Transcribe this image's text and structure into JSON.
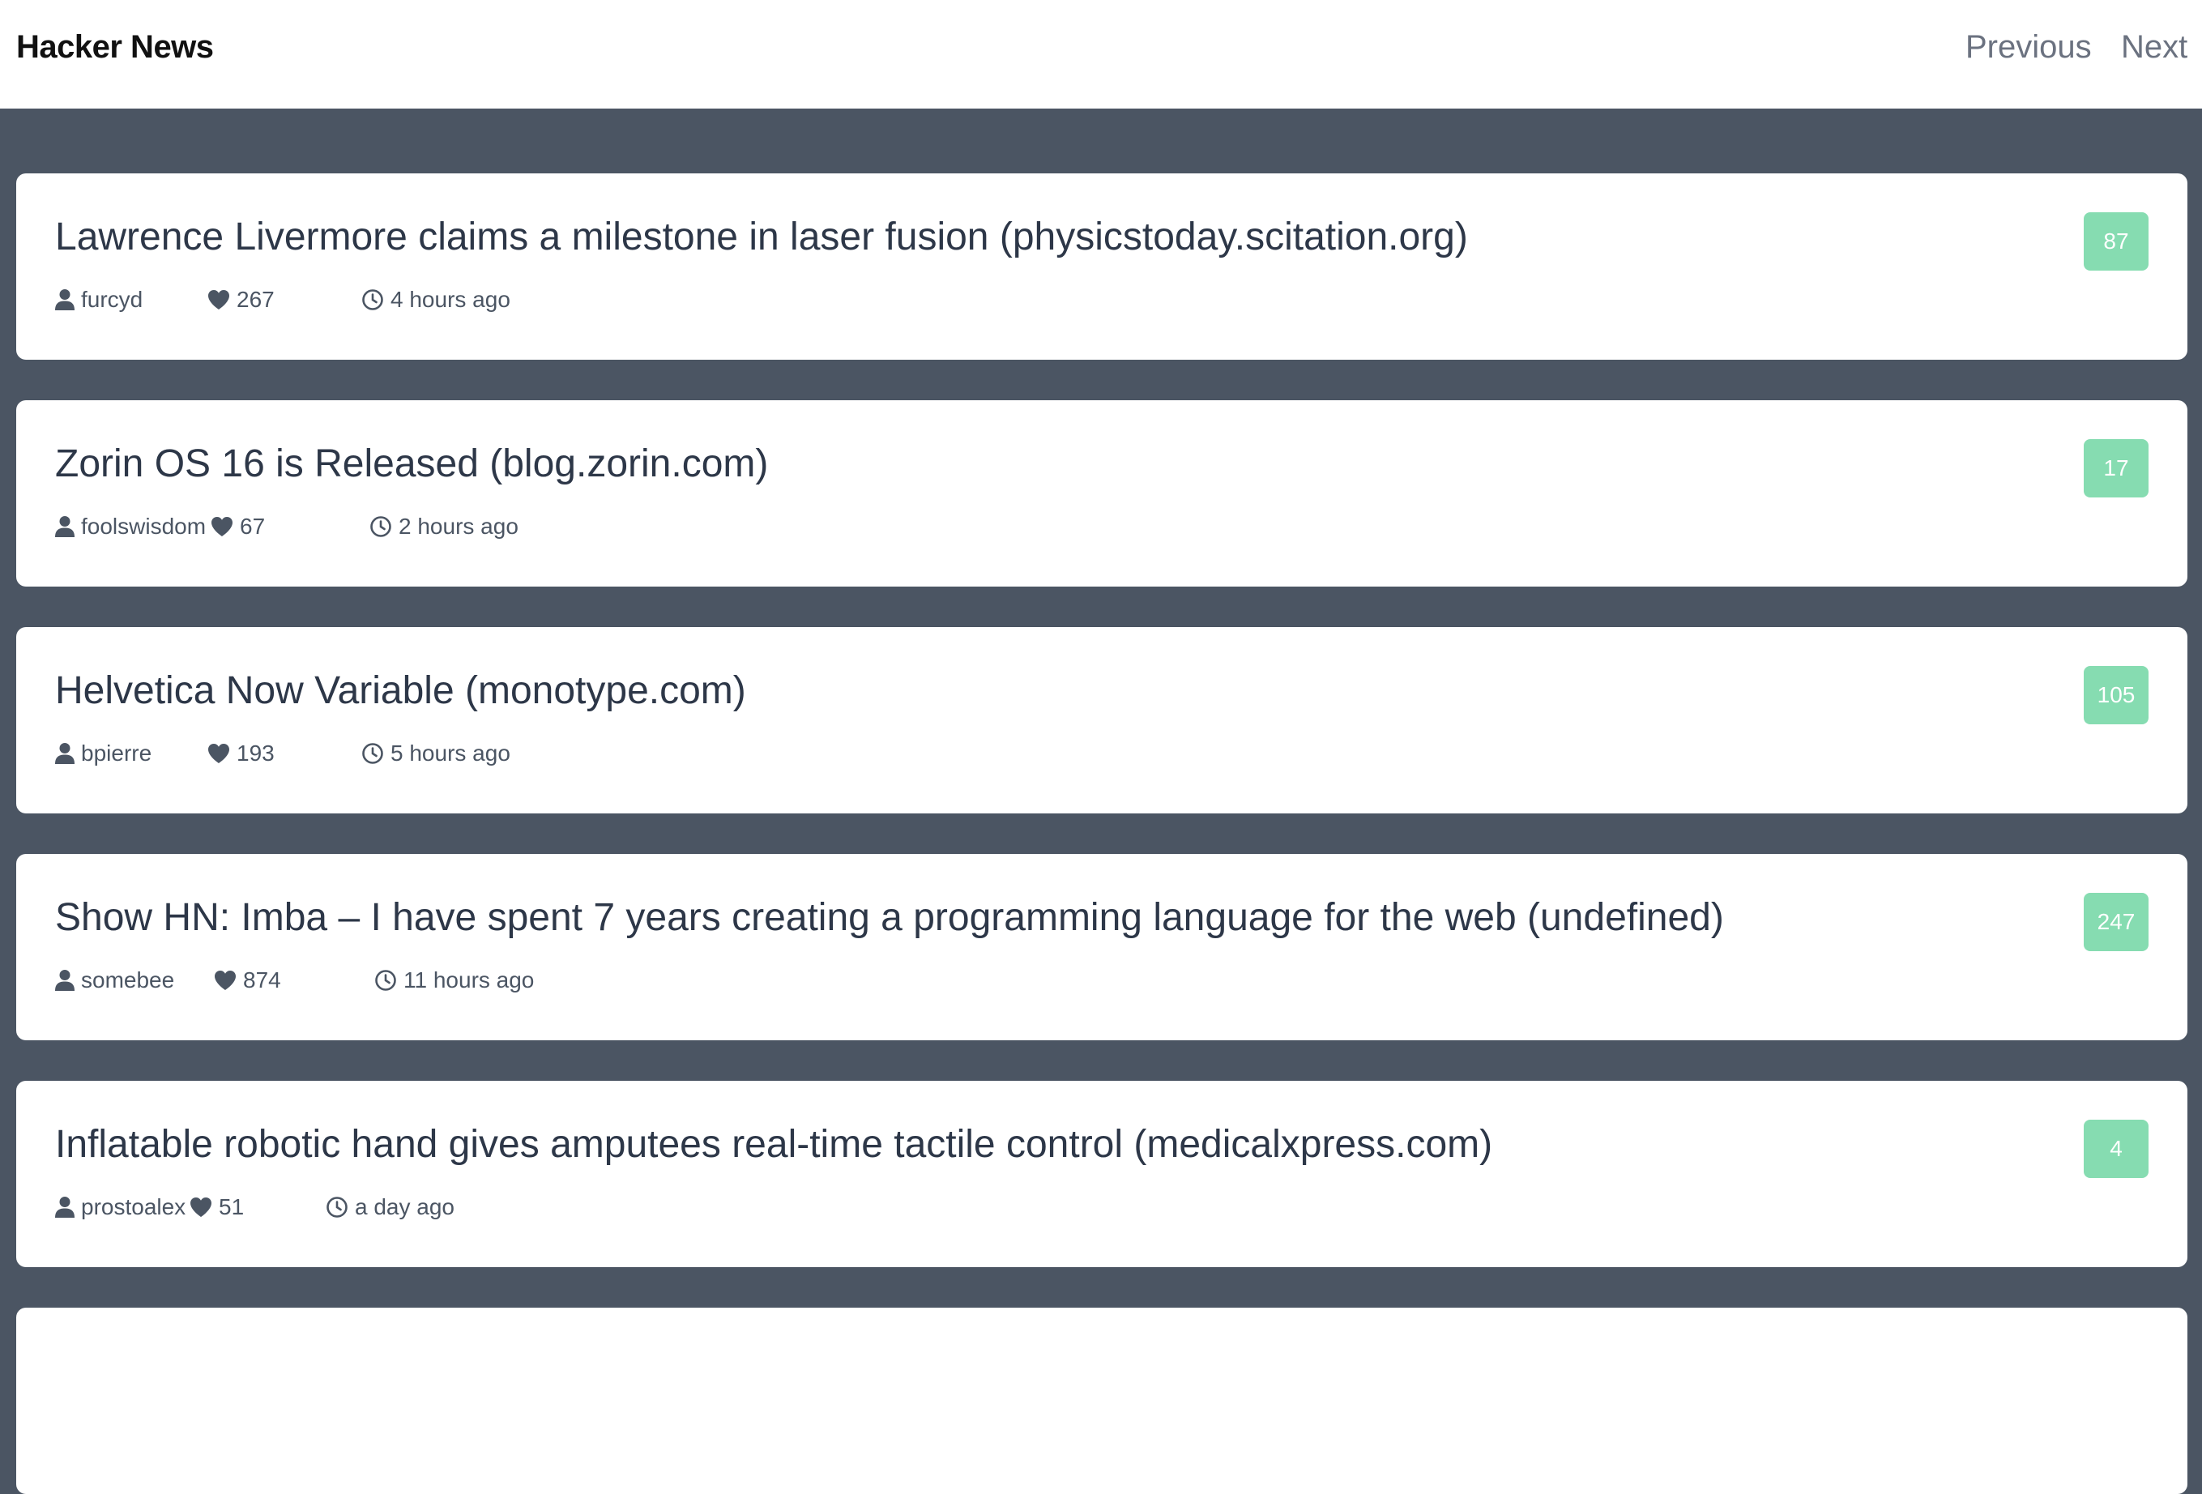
{
  "header": {
    "brand": "Hacker News",
    "previous_label": "Previous",
    "next_label": "Next"
  },
  "icons": {
    "user": "user-icon",
    "points": "heart-icon",
    "time": "clock-icon"
  },
  "colors": {
    "page_background": "#4b5563",
    "card_background": "#ffffff",
    "badge_background": "#86dcb1",
    "title_text": "#2d3748",
    "meta_text": "#4b5563"
  },
  "stories": [
    {
      "title": "Lawrence Livermore claims a milestone in laser fusion (physicstoday.scitation.org)",
      "author": "furcyd",
      "points": "267",
      "time": "4 hours ago",
      "comments": "87"
    },
    {
      "title": "Zorin OS 16 is Released (blog.zorin.com)",
      "author": "foolswisdom",
      "points": "67",
      "time": "2 hours ago",
      "comments": "17"
    },
    {
      "title": "Helvetica Now Variable (monotype.com)",
      "author": "bpierre",
      "points": "193",
      "time": "5 hours ago",
      "comments": "105"
    },
    {
      "title": "Show HN: Imba – I have spent 7 years creating a programming language for the web (undefined)",
      "author": "somebee",
      "points": "874",
      "time": "11 hours ago",
      "comments": "247"
    },
    {
      "title": "Inflatable robotic hand gives amputees real-time tactile control (medicalxpress.com)",
      "author": "prostoalex",
      "points": "51",
      "time": "a day ago",
      "comments": "4"
    }
  ]
}
